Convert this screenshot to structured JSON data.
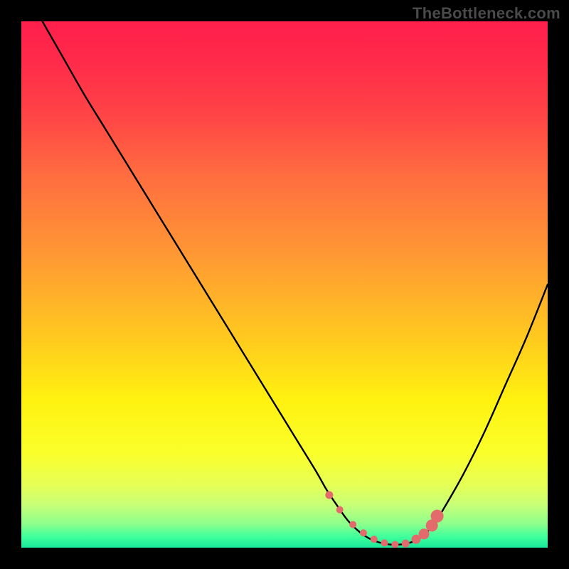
{
  "watermark": "TheBottleneck.com",
  "colors": {
    "curve_stroke": "#000000",
    "marker_fill": "#e46b6b",
    "marker_stroke": "#e46b6b",
    "frame_bg": "#000000"
  },
  "gradient_stops": [
    {
      "offset": 0,
      "color": "#ff1f4b"
    },
    {
      "offset": 0.08,
      "color": "#ff2b4a"
    },
    {
      "offset": 0.18,
      "color": "#ff4546"
    },
    {
      "offset": 0.3,
      "color": "#ff6f3f"
    },
    {
      "offset": 0.45,
      "color": "#ff9a33"
    },
    {
      "offset": 0.6,
      "color": "#ffc91f"
    },
    {
      "offset": 0.72,
      "color": "#fff210"
    },
    {
      "offset": 0.82,
      "color": "#faff2a"
    },
    {
      "offset": 0.88,
      "color": "#e6ff55"
    },
    {
      "offset": 0.92,
      "color": "#c6ff78"
    },
    {
      "offset": 0.955,
      "color": "#8cff8c"
    },
    {
      "offset": 0.98,
      "color": "#3dff9c"
    },
    {
      "offset": 1.0,
      "color": "#19e89a"
    }
  ],
  "chart_data": {
    "type": "line",
    "title": "",
    "xlabel": "",
    "ylabel": "",
    "xlim": [
      0,
      100
    ],
    "ylim": [
      0,
      100
    ],
    "series": [
      {
        "name": "bottleneck-curve",
        "x": [
          4,
          8,
          12,
          16,
          20,
          24,
          28,
          32,
          36,
          40,
          44,
          48,
          52,
          56,
          58,
          60,
          62,
          64,
          66,
          68,
          70,
          72,
          74,
          76,
          78,
          80,
          84,
          88,
          92,
          96,
          100
        ],
        "y": [
          100,
          93,
          86,
          79.5,
          73,
          66.5,
          60,
          53.5,
          47,
          40.5,
          34,
          27.5,
          21,
          14.5,
          11,
          8,
          5.2,
          3.2,
          1.8,
          1.0,
          0.6,
          0.6,
          1.0,
          2.0,
          4.0,
          7.0,
          14,
          22,
          31,
          40,
          50
        ]
      }
    ],
    "markers": {
      "name": "bottleneck-sweet-spot",
      "x": [
        58.5,
        60.5,
        63,
        65,
        67,
        69,
        71,
        73,
        75,
        76.5,
        78,
        79
      ],
      "y": [
        10.0,
        7.2,
        4.4,
        2.8,
        1.6,
        0.9,
        0.6,
        0.8,
        1.6,
        2.6,
        4.2,
        6.0
      ],
      "r": [
        5,
        4.5,
        4.5,
        4.5,
        4.5,
        4.5,
        4.5,
        5,
        6,
        7,
        8,
        8.5
      ]
    }
  }
}
